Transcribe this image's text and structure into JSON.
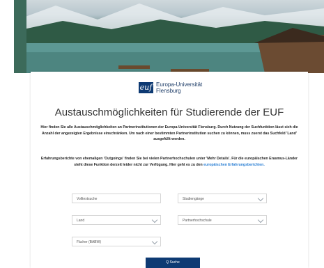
{
  "logo": {
    "mark": "euf",
    "line1": "Europa-Universität",
    "line2": "Flensburg"
  },
  "page_title": "Austauschmöglichkeiten für Studierende der EUF",
  "intro_text": "Hier finden Sie alle Austauschmöglichkeiten an Partnerinstitutionen der Europa-Universität Flensburg. Durch Nutzung der Suchfunktion lässt sich die Anzahl der angezeigten Ergebnisse einschränken. Um nach einer bestimmten Partnerinstitution suchen zu können, muss zuerst das Suchfeld 'Land' ausgefüllt werden.",
  "reports_text": "Erfahrungsberichte von ehemaligen 'Outgoings' finden Sie bei vielen Partnerhochschulen unter 'Mehr Details'. Für die europäischen Erasmus-Länder steht diese Funktion derzeit leider nicht zur Verfügung. Hier geht es zu den",
  "reports_link": "europäischen Erfahrungsberichten.",
  "filters": {
    "fulltext": "Volltextsuche",
    "programs": "Studiengänge",
    "country": "Land",
    "partner": "Partnerhochschule",
    "subjects": "Fächer (BABW)"
  },
  "search_button": "Q  Suche"
}
